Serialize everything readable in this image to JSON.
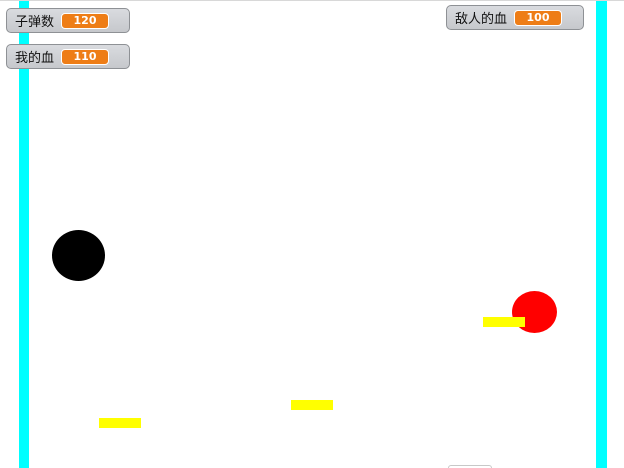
{
  "monitors": {
    "bullets": {
      "label": "子弹数",
      "value": "120"
    },
    "my_hp": {
      "label": "我的血",
      "value": "110"
    },
    "enemy_hp": {
      "label": "敌人的血",
      "value": "100"
    }
  },
  "colors": {
    "wall": "#00ffff",
    "player_ball": "#000000",
    "enemy_ball": "#ff0000",
    "bullet": "#ffff00",
    "monitor_value": "#ee7d16"
  }
}
